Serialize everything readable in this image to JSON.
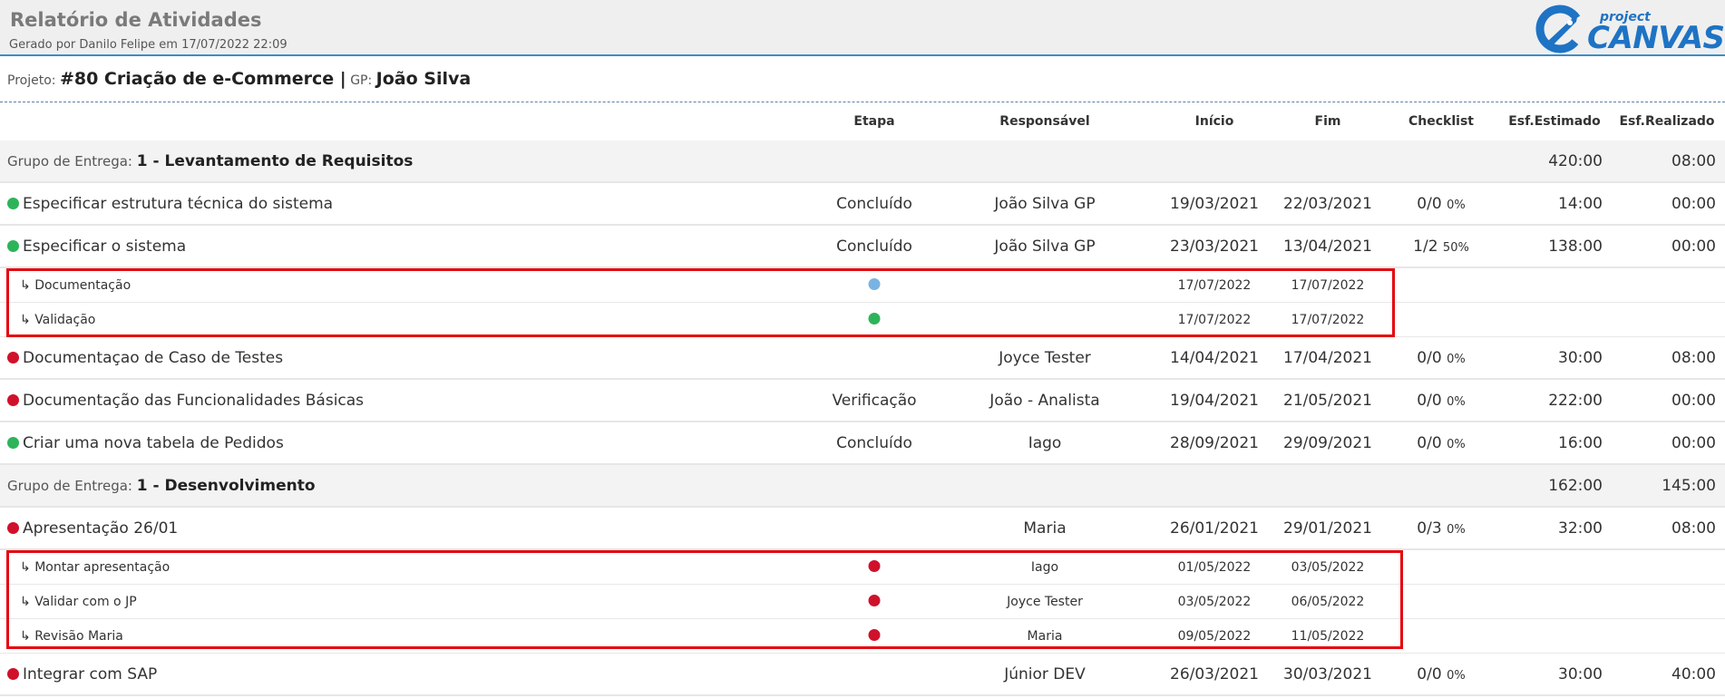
{
  "header": {
    "title": "Relatório de Atividades",
    "subtitle": "Gerado por Danilo Felipe em 17/07/2022 22:09",
    "logo_small": "project",
    "logo_big": "CANVAS"
  },
  "project": {
    "label": "Projeto:",
    "name": "#80 Criação de e-Commerce |",
    "gp_label": "GP:",
    "gp_name": "João Silva"
  },
  "columns": {
    "etapa": "Etapa",
    "responsavel": "Responsável",
    "inicio": "Início",
    "fim": "Fim",
    "checklist": "Checklist",
    "estimado": "Esf.Estimado",
    "realizado": "Esf.Realizado"
  },
  "group_label": "Grupo de Entrega:",
  "groups": [
    {
      "name": "1 - Levantamento de Requisitos",
      "estimado": "420:00",
      "realizado": "08:00"
    },
    {
      "name": "1 - Desenvolvimento",
      "estimado": "162:00",
      "realizado": "145:00"
    }
  ],
  "tasks": [
    {
      "status": "green",
      "name": "Especificar estrutura técnica do sistema",
      "etapa": "Concluído",
      "responsavel": "João Silva GP",
      "inicio": "19/03/2021",
      "fim": "22/03/2021",
      "checklist": "0/0",
      "pct": "0%",
      "estimado": "14:00",
      "realizado": "00:00"
    },
    {
      "status": "green",
      "name": "Especificar o sistema",
      "etapa": "Concluído",
      "responsavel": "João Silva GP",
      "inicio": "23/03/2021",
      "fim": "13/04/2021",
      "checklist": "1/2",
      "pct": "50%",
      "estimado": "138:00",
      "realizado": "00:00"
    },
    {
      "status": "red",
      "name": "Documentaçao de Caso de Testes",
      "etapa": "",
      "responsavel": "Joyce Tester",
      "inicio": "14/04/2021",
      "fim": "17/04/2021",
      "checklist": "0/0",
      "pct": "0%",
      "estimado": "30:00",
      "realizado": "08:00"
    },
    {
      "status": "red",
      "name": "Documentação das Funcionalidades Básicas",
      "etapa": "Verificação",
      "responsavel": "João - Analista",
      "inicio": "19/04/2021",
      "fim": "21/05/2021",
      "checklist": "0/0",
      "pct": "0%",
      "estimado": "222:00",
      "realizado": "00:00"
    },
    {
      "status": "green",
      "name": "Criar uma nova tabela de Pedidos",
      "etapa": "Concluído",
      "responsavel": "Iago",
      "inicio": "28/09/2021",
      "fim": "29/09/2021",
      "checklist": "0/0",
      "pct": "0%",
      "estimado": "16:00",
      "realizado": "00:00"
    },
    {
      "status": "red",
      "name": "Apresentação 26/01",
      "etapa": "",
      "responsavel": "Maria",
      "inicio": "26/01/2021",
      "fim": "29/01/2021",
      "checklist": "0/3",
      "pct": "0%",
      "estimado": "32:00",
      "realizado": "08:00"
    },
    {
      "status": "red",
      "name": "Integrar com SAP",
      "etapa": "",
      "responsavel": "Júnior DEV",
      "inicio": "26/03/2021",
      "fim": "30/03/2021",
      "checklist": "0/0",
      "pct": "0%",
      "estimado": "30:00",
      "realizado": "40:00"
    }
  ],
  "subtasks": [
    {
      "status": "blue",
      "name": "Documentação",
      "responsavel": "",
      "inicio": "17/07/2022",
      "fim": "17/07/2022"
    },
    {
      "status": "green",
      "name": "Validação",
      "responsavel": "",
      "inicio": "17/07/2022",
      "fim": "17/07/2022"
    },
    {
      "status": "red",
      "name": "Montar apresentação",
      "responsavel": "Iago",
      "inicio": "01/05/2022",
      "fim": "03/05/2022"
    },
    {
      "status": "red",
      "name": "Validar com o JP",
      "responsavel": "Joyce Tester",
      "inicio": "03/05/2022",
      "fim": "06/05/2022"
    },
    {
      "status": "red",
      "name": "Revisão Maria",
      "responsavel": "Maria",
      "inicio": "09/05/2022",
      "fim": "11/05/2022"
    }
  ],
  "subtask_arrow": "↳",
  "status_colors": {
    "green": "#2db45a",
    "red": "#d0112b",
    "blue": "#7ab3e2",
    "highlight": "#e4080f",
    "accent": "#1e73c4"
  }
}
